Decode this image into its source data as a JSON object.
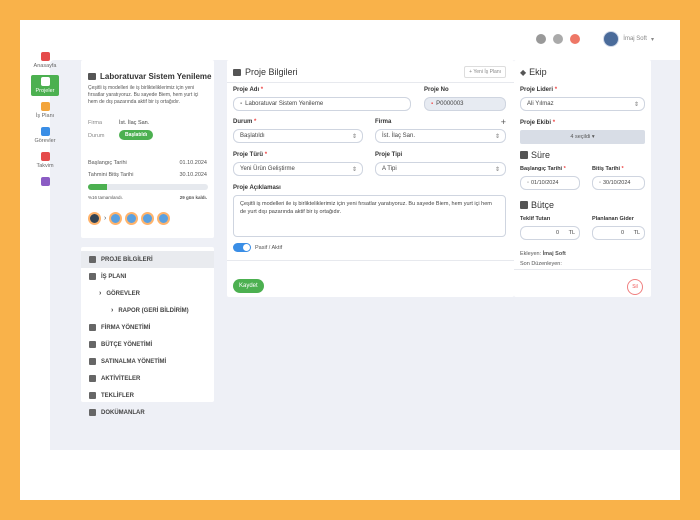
{
  "header": {
    "user_name": "İmaj Soft",
    "icons": [
      "settings-icon",
      "help-icon",
      "notification-icon"
    ]
  },
  "nav": [
    {
      "label": "Anasayfa",
      "icon": "home-icon",
      "color": "#e54b4b",
      "active": false
    },
    {
      "label": "Projeler",
      "icon": "projects-icon",
      "color": "#ffffff",
      "active": true
    },
    {
      "label": "İş Planı",
      "icon": "workplan-icon",
      "color": "#f3a53b",
      "active": false
    },
    {
      "label": "Görevler",
      "icon": "tasks-icon",
      "color": "#3a8ee6",
      "active": false
    },
    {
      "label": "Takvim",
      "icon": "calendar-icon",
      "color": "#e54b4b",
      "active": false
    },
    {
      "label": "",
      "icon": "users-icon",
      "color": "#8b5cc4",
      "active": false
    }
  ],
  "summary": {
    "title": "Laboratuvar Sistem Yenileme",
    "description": "Çeşitli iş modelleri ile iş birlikteliklerimiz için yeni fırsatlar yaratıyoruz. Bu sayede Biem, hem yurt içi hem de dış pazarında aktif bir iş ortağıdır.",
    "firma_label": "Firma",
    "firma_value": "İst. İlaç San.",
    "durum_label": "Durum",
    "durum_value": "Başlatıldı",
    "start_label": "Başlangıç Tarihi",
    "start_value": "01.10.2024",
    "end_label": "Tahmini Bitiş Tarihi",
    "end_value": "30.10.2024",
    "progress_text": "%16 tamamlandı.",
    "days_left": "29 gün kaldı.",
    "progress_percent": 16
  },
  "menu": [
    {
      "label": "PROJE BİLGİLERİ",
      "icon": "briefcase-icon",
      "level": 0,
      "active": true
    },
    {
      "label": "İŞ PLANI",
      "icon": "sitemap-icon",
      "level": 0,
      "active": false
    },
    {
      "label": "GÖREVLER",
      "icon": "chevron-right-icon",
      "level": 1,
      "active": false
    },
    {
      "label": "RAPOR (GERİ BİLDİRİM)",
      "icon": "chevron-right-icon",
      "level": 2,
      "active": false
    },
    {
      "label": "FİRMA YÖNETİMİ",
      "icon": "building-icon",
      "level": 0,
      "active": false
    },
    {
      "label": "BÜTÇE YÖNETİMİ",
      "icon": "budget-icon",
      "level": 0,
      "active": false
    },
    {
      "label": "SATINALMA YÖNETİMİ",
      "icon": "basket-icon",
      "level": 0,
      "active": false
    },
    {
      "label": "AKTİVİTELER",
      "icon": "activity-icon",
      "level": 0,
      "active": false
    },
    {
      "label": "TEKLİFLER",
      "icon": "folder-icon",
      "level": 0,
      "active": false
    },
    {
      "label": "DOKÜMANLAR",
      "icon": "document-icon",
      "level": 0,
      "active": false
    }
  ],
  "main": {
    "title": "Proje Bilgileri",
    "new_plan": "+ Yeni İş Planı",
    "proje_adi_label": "Proje Adı",
    "proje_adi_value": "Laboratuvar Sistem Yenileme",
    "proje_no_label": "Proje No",
    "proje_no_value": "P0000003",
    "durum_label": "Durum",
    "durum_value": "Başlatıldı",
    "firma_label": "Firma",
    "firma_value": "İst. İlaç San.",
    "turu_label": "Proje Türü",
    "turu_value": "Yeni Ürün Geliştirme",
    "tipi_label": "Proje Tipi",
    "tipi_value": "A Tipi",
    "aciklama_label": "Proje Açıklaması",
    "aciklama_value": "Çeşitli iş modelleri ile iş birlikteliklerimiz için yeni fırsatlar yaratıyoruz. Bu sayede Biem, hem yurt içi hem de yurt dışı pazarında aktif bir iş ortağıdır.",
    "toggle_label": "Pasif / Aktif",
    "save_label": "Kaydet"
  },
  "right": {
    "ekip_title": "Ekip",
    "lider_label": "Proje Lideri",
    "lider_value": "Ali Yılmaz",
    "ekibi_label": "Proje Ekibi",
    "ekibi_value": "4 seçildi",
    "sure_title": "Süre",
    "bas_label": "Başlangıç Tarihi",
    "bas_value": "01/10/2024",
    "bit_label": "Bitiş Tarihi",
    "bit_value": "30/10/2024",
    "butce_title": "Bütçe",
    "teklif_label": "Teklif Tutarı",
    "teklif_value": "0",
    "planlanan_label": "Planlanan Gider",
    "planlanan_value": "0",
    "currency": "TL",
    "ekleyen_label": "Ekleyen:",
    "ekleyen_value": "İmaj Soft",
    "son_label": "Son Düzenleyen:",
    "sil_label": "Sil"
  }
}
